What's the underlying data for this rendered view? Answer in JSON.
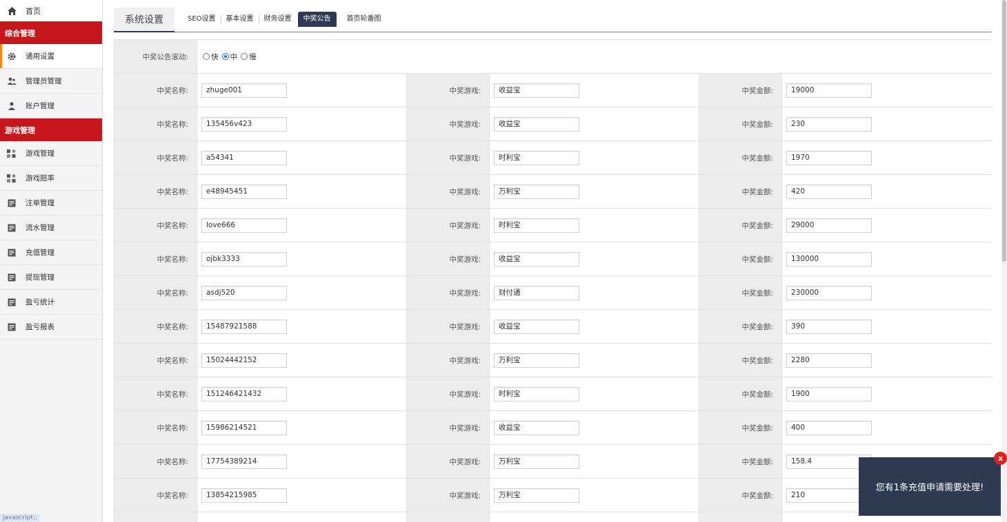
{
  "sidebar": {
    "home_label": "首页",
    "sections": [
      {
        "title": "综合管理",
        "items": [
          {
            "label": "通用设置",
            "icon": "gear-icon",
            "active": true
          },
          {
            "label": "管理员管理",
            "icon": "users-icon"
          },
          {
            "label": "账户管理",
            "icon": "user-icon"
          }
        ]
      },
      {
        "title": "游戏管理",
        "items": [
          {
            "label": "游戏管理",
            "icon": "grid-icon"
          },
          {
            "label": "游戏赔率",
            "icon": "grid-icon"
          },
          {
            "label": "注单管理",
            "icon": "file-icon"
          },
          {
            "label": "流水管理",
            "icon": "file-icon"
          },
          {
            "label": "充值管理",
            "icon": "file-icon"
          },
          {
            "label": "提现管理",
            "icon": "file-icon"
          },
          {
            "label": "盈亏统计",
            "icon": "file-icon"
          },
          {
            "label": "盈亏报表",
            "icon": "file-icon"
          }
        ]
      }
    ],
    "js_badge": "javascript:;"
  },
  "header": {
    "title": "系统设置",
    "tabs": [
      "SEO设置",
      "基本设置",
      "财务设置",
      "中奖公告",
      "首页轮番图"
    ],
    "active_tab": "中奖公告"
  },
  "scroll_setting": {
    "label": "中奖公告滚动:",
    "options": [
      "快",
      "中",
      "慢"
    ],
    "selected": "中"
  },
  "labels": {
    "name": "中奖名称:",
    "game": "中奖游戏:",
    "amount": "中奖金额:"
  },
  "rows": [
    {
      "name": "zhuge001",
      "game": "收益宝",
      "amount": "19000"
    },
    {
      "name": "135456v423",
      "game": "收益宝",
      "amount": "230"
    },
    {
      "name": "a54341",
      "game": "时利宝",
      "amount": "1970"
    },
    {
      "name": "e48945451",
      "game": "万利宝",
      "amount": "420"
    },
    {
      "name": "love666",
      "game": "时利宝",
      "amount": "29000"
    },
    {
      "name": "ojbk3333",
      "game": "收益宝",
      "amount": "130000"
    },
    {
      "name": "asdj520",
      "game": "财付通",
      "amount": "230000"
    },
    {
      "name": "15487921588",
      "game": "收益宝",
      "amount": "390"
    },
    {
      "name": "15024442152",
      "game": "万利宝",
      "amount": "2280"
    },
    {
      "name": "151246421432",
      "game": "时利宝",
      "amount": "1900"
    },
    {
      "name": "15986214521",
      "game": "收益宝",
      "amount": "400"
    },
    {
      "name": "17754389214",
      "game": "万利宝",
      "amount": "158.4"
    },
    {
      "name": "13854215985",
      "game": "万利宝",
      "amount": "210"
    },
    {
      "name": "",
      "game": "",
      "amount": ""
    }
  ],
  "toast": {
    "message": "您有1条充值申请需要处理!",
    "close_label": "x"
  },
  "colors": {
    "section_red": "#c8161d",
    "active_orange": "#f7861c",
    "navy": "#2e3a52",
    "close_red": "#e0201e"
  }
}
